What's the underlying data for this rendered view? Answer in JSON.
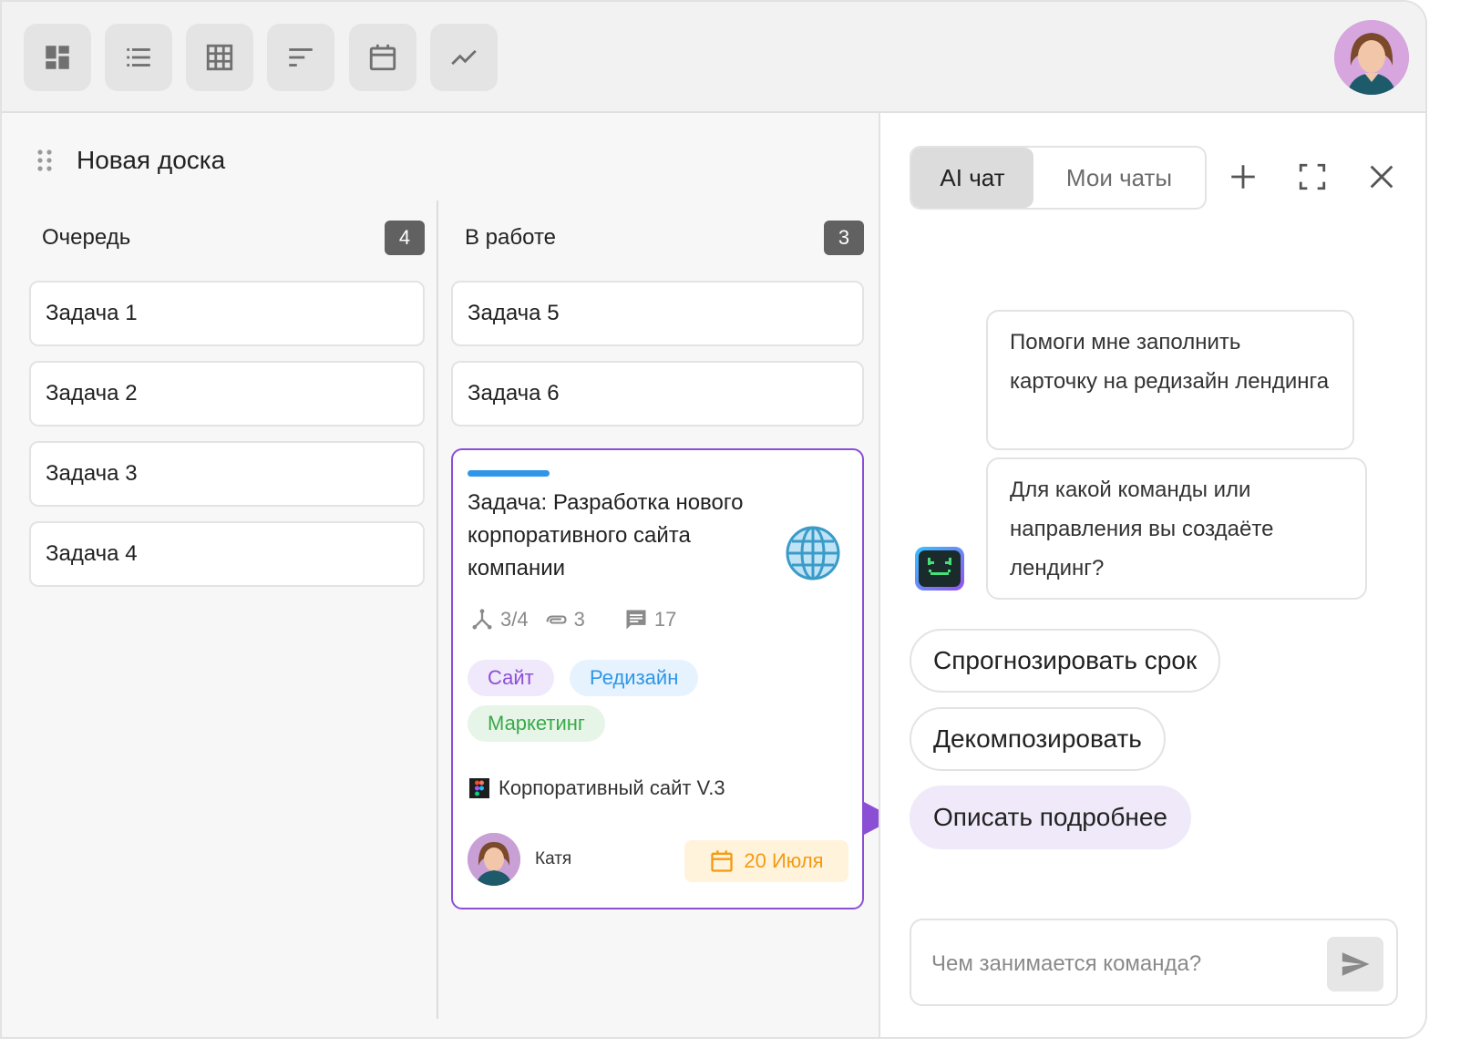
{
  "toolbar": {
    "views": [
      {
        "icon": "dashboard-icon"
      },
      {
        "icon": "list-icon"
      },
      {
        "icon": "table-icon"
      },
      {
        "icon": "gantt-icon"
      },
      {
        "icon": "calendar-icon"
      },
      {
        "icon": "chart-icon"
      }
    ],
    "user_avatar": "user-avatar"
  },
  "board": {
    "title": "Новая доска",
    "columns": [
      {
        "title": "Очередь",
        "count": "4",
        "cards": [
          "Задача 1",
          "Задача 2",
          "Задача 3",
          "Задача 4"
        ]
      },
      {
        "title": "В работе",
        "count": "3",
        "cards": [
          "Задача 5",
          "Задача 6"
        ]
      }
    ],
    "featured_card": {
      "title": "Задача: Разработка нового корпоративного сайта компании",
      "subtasks": "3/4",
      "attachments": "3",
      "comments": "17",
      "tags": [
        "Сайт",
        "Редизайн",
        "Маркетинг"
      ],
      "figma_link": "Корпоративный сайт V.3",
      "assignee": "Катя",
      "due_date": "20 Июля",
      "colors": {
        "accent": "#2f96e8",
        "border": "#8b4fd6",
        "due": "#f39b12"
      }
    }
  },
  "chat": {
    "tabs": [
      "AI чат",
      "Мои чаты"
    ],
    "messages": [
      "Помоги мне заполнить карточку на редизайн лендинга",
      "Для какой команды или направления вы создаёте лендинг?"
    ],
    "suggestions": [
      "Спрогнозировать срок",
      "Декомпозировать",
      "Описать подробнее"
    ],
    "input_placeholder": "Чем занимается команда?"
  }
}
